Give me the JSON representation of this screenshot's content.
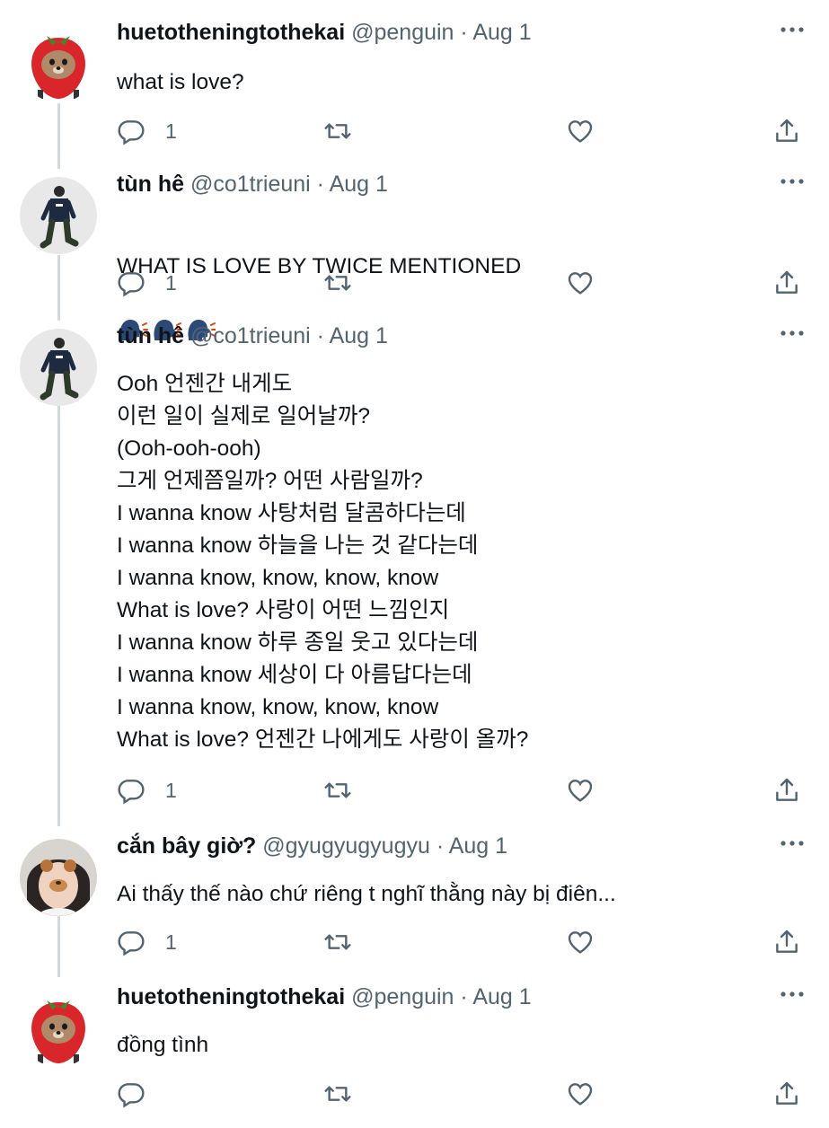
{
  "tweets": [
    {
      "name": "huetotheningtothekai",
      "handle": "@penguin",
      "sep": " · ",
      "date": "Aug 1",
      "text": "what is love?",
      "reply_count": "1",
      "avatar_icon": "strawberry-dog-avatar"
    },
    {
      "name": "tùn hê",
      "handle": "@co1trieuni",
      "sep": " · ",
      "date": "Aug 1",
      "text": "WHAT IS LOVE BY TWICE MENTIONED",
      "emoji": "🗣️🗣️🗣️",
      "reply_count": "1",
      "avatar_icon": "walking-man-avatar"
    },
    {
      "name": "tùn hê",
      "handle": "@co1trieuni",
      "sep": " · ",
      "date": "Aug 1",
      "text": "Ooh 언젠간 내게도\n이런 일이 실제로 일어날까?\n(Ooh-ooh-ooh)\n그게 언제쯤일까? 어떤 사람일까?\nI wanna know 사탕처럼 달콤하다는데\nI wanna know 하늘을 나는 것 같다는데\nI wanna know, know, know, know\nWhat is love? 사랑이 어떤 느낌인지\nI wanna know 하루 종일 웃고 있다는데\nI wanna know 세상이 다 아름답다는데\nI wanna know, know, know, know\nWhat is love? 언젠간 나에게도 사랑이 올까?",
      "reply_count": "1",
      "avatar_icon": "walking-man-avatar"
    },
    {
      "name": "cắn bây giờ?",
      "handle": "@gyugyugyugyu",
      "sep": " · ",
      "date": "Aug 1",
      "text": "Ai thấy thế nào chứ riêng t nghĩ thằng này bị điên...",
      "reply_count": "1",
      "avatar_icon": "bear-filter-avatar"
    },
    {
      "name": "huetotheningtothekai",
      "handle": "@penguin",
      "sep": " · ",
      "date": "Aug 1",
      "text": "đồng tình",
      "reply_count": "",
      "avatar_icon": "strawberry-dog-avatar"
    }
  ],
  "colors": {
    "text": "#0f1419",
    "secondary": "#536471",
    "thread_line": "#cfd9de",
    "icon": "#536471"
  },
  "icons": [
    "reply-icon",
    "retweet-icon",
    "like-icon",
    "share-icon",
    "more-icon"
  ]
}
